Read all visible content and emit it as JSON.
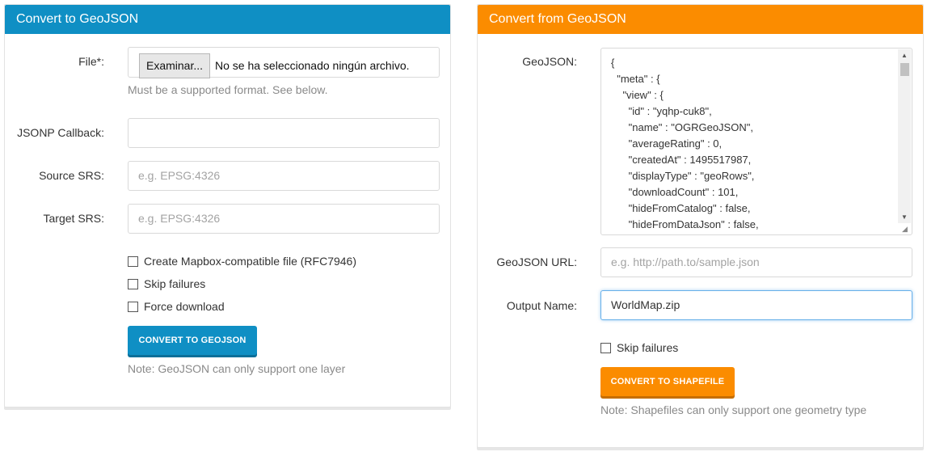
{
  "left": {
    "title": "Convert to GeoJSON",
    "file_label": "File*:",
    "file_button": "Examinar...",
    "file_status": "No se ha seleccionado ningún archivo.",
    "file_help": "Must be a supported format. See below.",
    "jsonp_label": "JSONP Callback:",
    "jsonp_value": "",
    "source_label": "Source SRS:",
    "source_placeholder": "e.g. EPSG:4326",
    "target_label": "Target SRS:",
    "target_placeholder": "e.g. EPSG:4326",
    "options": [
      {
        "label": "Create Mapbox-compatible file (RFC7946)",
        "checked": false
      },
      {
        "label": "Skip failures",
        "checked": false
      },
      {
        "label": "Force download",
        "checked": false
      }
    ],
    "button": "CONVERT TO GEOJSON",
    "note": "Note: GeoJSON can only support one layer"
  },
  "right": {
    "title": "Convert from GeoJSON",
    "geojson_label": "GeoJSON:",
    "geojson_lines": [
      "{",
      "  \"meta\" : {",
      "    \"view\" : {",
      "      \"id\" : \"yqhp-cuk8\",",
      "      \"name\" : \"OGRGeoJSON\",",
      "      \"averageRating\" : 0,",
      "      \"createdAt\" : 1495517987,",
      "      \"displayType\" : \"geoRows\",",
      "      \"downloadCount\" : 101,",
      "      \"hideFromCatalog\" : false,",
      "      \"hideFromDataJson\" : false,"
    ],
    "url_label": "GeoJSON URL:",
    "url_placeholder": "e.g. http://path.to/sample.json",
    "output_label": "Output Name:",
    "output_value": "WorldMap.zip",
    "skip_label": "Skip failures",
    "button": "CONVERT TO SHAPEFILE",
    "note": "Note: Shapefiles can only support one geometry type"
  },
  "colors": {
    "blue": "#0f8fc4",
    "orange": "#fb8c00"
  }
}
